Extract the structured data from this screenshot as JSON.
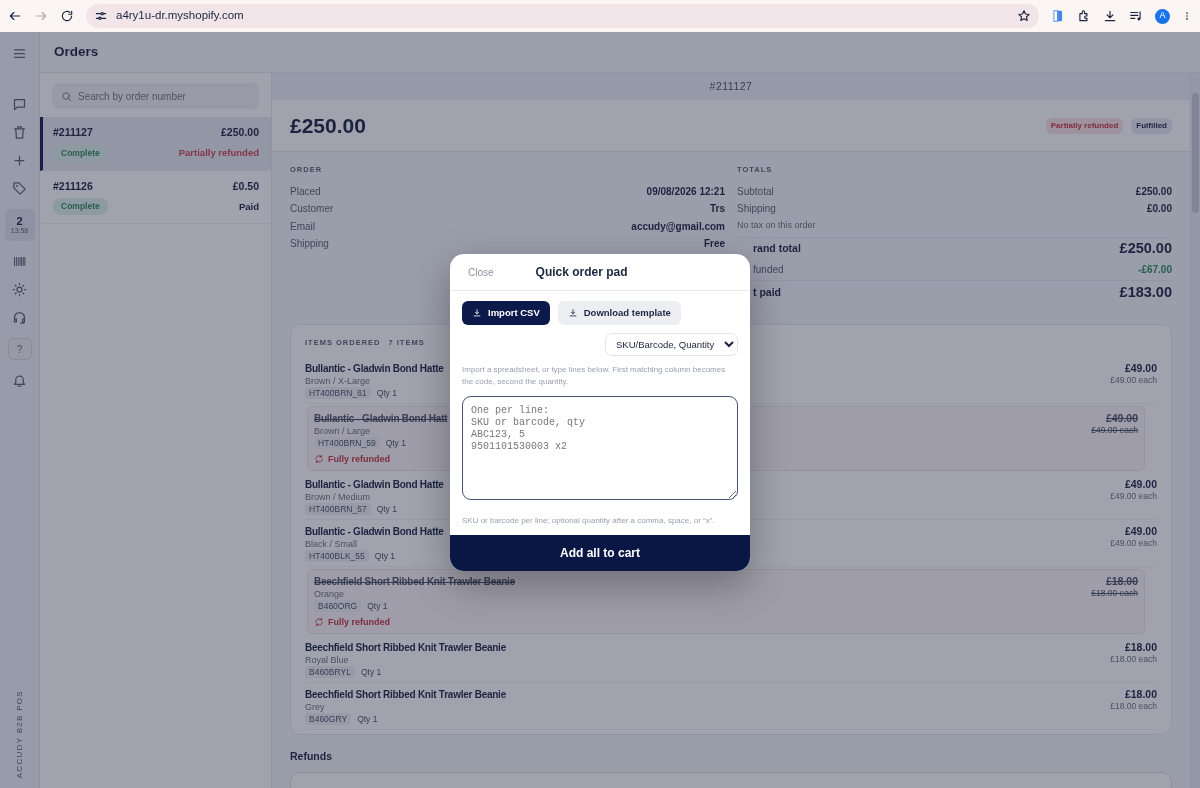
{
  "browser": {
    "url": "a4ry1u-dr.myshopify.com",
    "avatar": "A"
  },
  "rail": {
    "register": {
      "count": "2",
      "time": "13:58"
    },
    "help": "?",
    "brand": "ACCUDY B2B POS"
  },
  "orders_pane": {
    "title": "Orders",
    "search": {
      "placeholder": "Search by order number"
    },
    "orders": [
      {
        "number": "#211127",
        "total": "£250.00",
        "status": "Complete",
        "payment": "Partially refunded",
        "kind": "refund",
        "selected": true
      },
      {
        "number": "#211126",
        "total": "£0.50",
        "status": "Complete",
        "payment": "Paid",
        "kind": "paid",
        "selected": false
      }
    ]
  },
  "detail": {
    "number": "#211127",
    "total": "£250.00",
    "badges": [
      {
        "label": "Partially refunded",
        "kind": "danger"
      },
      {
        "label": "Fulfilled",
        "kind": "neutral"
      }
    ],
    "order": {
      "heading": "ORDER",
      "rows": [
        {
          "label": "Placed",
          "value": "09/08/2026 12:21"
        },
        {
          "label": "Customer",
          "value": "Trs"
        },
        {
          "label": "Email",
          "value": "accudy@gmail.com"
        },
        {
          "label": "Shipping",
          "value": "Free"
        }
      ]
    },
    "totals": {
      "heading": "TOTALS",
      "rows": [
        {
          "kind": "line",
          "label": "Subtotal",
          "value": "£250.00"
        },
        {
          "kind": "line",
          "label": "Shipping",
          "value": "£0.00"
        },
        {
          "kind": "note",
          "label": "No tax on this order"
        },
        {
          "kind": "grand",
          "label": "rand total",
          "value": "£250.00"
        },
        {
          "kind": "refund",
          "label": "funded",
          "value": "-£67.00"
        },
        {
          "kind": "grand",
          "label": "t paid",
          "value": "£183.00"
        }
      ]
    },
    "items": {
      "heading": "ITEMS ORDERED",
      "count": "7 ITEMS",
      "lines": [
        {
          "name": "Bullantic - Gladwin Bond Hatte",
          "variant": "Brown / X-Large",
          "sku": "HT400BRN_61",
          "qty": "Qty 1",
          "price": "£49.00",
          "each": "£49.00 each",
          "refunded": false
        },
        {
          "name": "Bullantic - Gladwin Bond Hatt",
          "variant": "Brown / Large",
          "sku": "HT400BRN_59",
          "qty": "Qty 1",
          "price": "£49.00",
          "each": "£49.00 each",
          "refunded": true,
          "note": "Fully refunded"
        },
        {
          "name": "Bullantic - Gladwin Bond Hatte",
          "variant": "Brown / Medium",
          "sku": "HT400BRN_57",
          "qty": "Qty 1",
          "price": "£49.00",
          "each": "£49.00 each",
          "refunded": false
        },
        {
          "name": "Bullantic - Gladwin Bond Hatte",
          "variant": "Black / Small",
          "sku": "HT400BLK_55",
          "qty": "Qty 1",
          "price": "£49.00",
          "each": "£49.00 each",
          "refunded": false
        },
        {
          "name": "Beechfield Short Ribbed Knit Trawler Beanie",
          "variant": "Orange",
          "sku": "B460ORG",
          "qty": "Qty 1",
          "price": "£18.00",
          "each": "£18.00 each",
          "refunded": true,
          "note": "Fully refunded"
        },
        {
          "name": "Beechfield Short Ribbed Knit Trawler Beanie",
          "variant": "Royal Blue",
          "sku": "B460BRYL",
          "qty": "Qty 1",
          "price": "£18.00",
          "each": "£18.00 each",
          "refunded": false
        },
        {
          "name": "Beechfield Short Ribbed Knit Trawler Beanie",
          "variant": "Grey",
          "sku": "B460GRY",
          "qty": "Qty 1",
          "price": "£18.00",
          "each": "£18.00 each",
          "refunded": false
        }
      ]
    },
    "refunds_heading": "Refunds"
  },
  "modal": {
    "close": "Close",
    "title": "Quick order pad",
    "import_button": "Import CSV",
    "template_button": "Download template",
    "format_select": "SKU/Barcode, Quantity",
    "intro": "Import a spreadsheet, or type lines below. First matching column becomes the code, second the quantity.",
    "textarea": {
      "placeholder": "One per line:\nSKU or barcode, qty\nABC123, 5\n9501101530003 x2"
    },
    "hint": "SKU or barcode per line; optional quantity after a comma, space, or “x”.",
    "submit": "Add all to cart"
  }
}
